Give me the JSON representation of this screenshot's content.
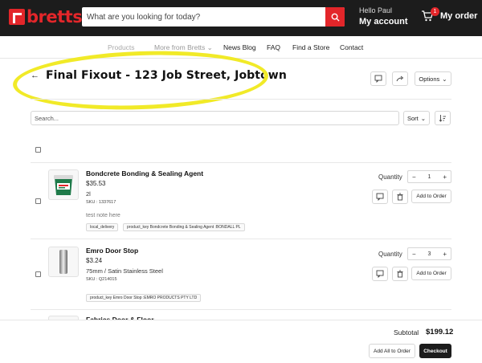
{
  "header": {
    "logo_text": "bretts",
    "search_placeholder": "What are you looking for today?",
    "account_greeting": "Hello Paul",
    "account_link": "My account",
    "cart_count": "1",
    "cart_label": "My order",
    "brand_color": "#e3262a"
  },
  "nav": {
    "items": [
      {
        "label": "Products"
      },
      {
        "label": "More from Bretts"
      },
      {
        "label": "News Blog"
      },
      {
        "label": "FAQ"
      },
      {
        "label": "Find a Store"
      },
      {
        "label": "Contact"
      }
    ]
  },
  "page": {
    "title": "Final Fixout - 123 Job Street, Jobtown",
    "options_label": "Options",
    "filter_placeholder": "Search...",
    "sort_label": "Sort"
  },
  "products": [
    {
      "name": "Bondcrete Bonding & Sealing Agent",
      "price": "$35.53",
      "variant": "2l",
      "sku": "SKU : 1337617",
      "note": "test note here",
      "tags": [
        "local_delivery",
        "product_key Bondcrete Bonding & Sealing Agent :BONDALL PL"
      ],
      "qty_label": "Quantity",
      "qty": "1",
      "add_label": "Add to Order"
    },
    {
      "name": "Emro Door Stop",
      "price": "$3.24",
      "variant": "75mm / Satin Stainless Steel",
      "sku": "SKU : Q214015",
      "note": "",
      "tags": [
        "product_key Emro Door Stop :EMRO PRODUCTS PTY LTD"
      ],
      "qty_label": "Quantity",
      "qty": "3",
      "add_label": "Add to Order"
    },
    {
      "name": "Fabrics Door & Floor",
      "price": "",
      "variant": "",
      "sku": "",
      "note": "",
      "tags": [],
      "qty_label": "",
      "qty": "",
      "add_label": ""
    }
  ],
  "footer": {
    "subtotal_label": "Subtotal",
    "subtotal_value": "$199.12",
    "add_all_label": "Add All to Order",
    "checkout_label": "Checkout"
  }
}
